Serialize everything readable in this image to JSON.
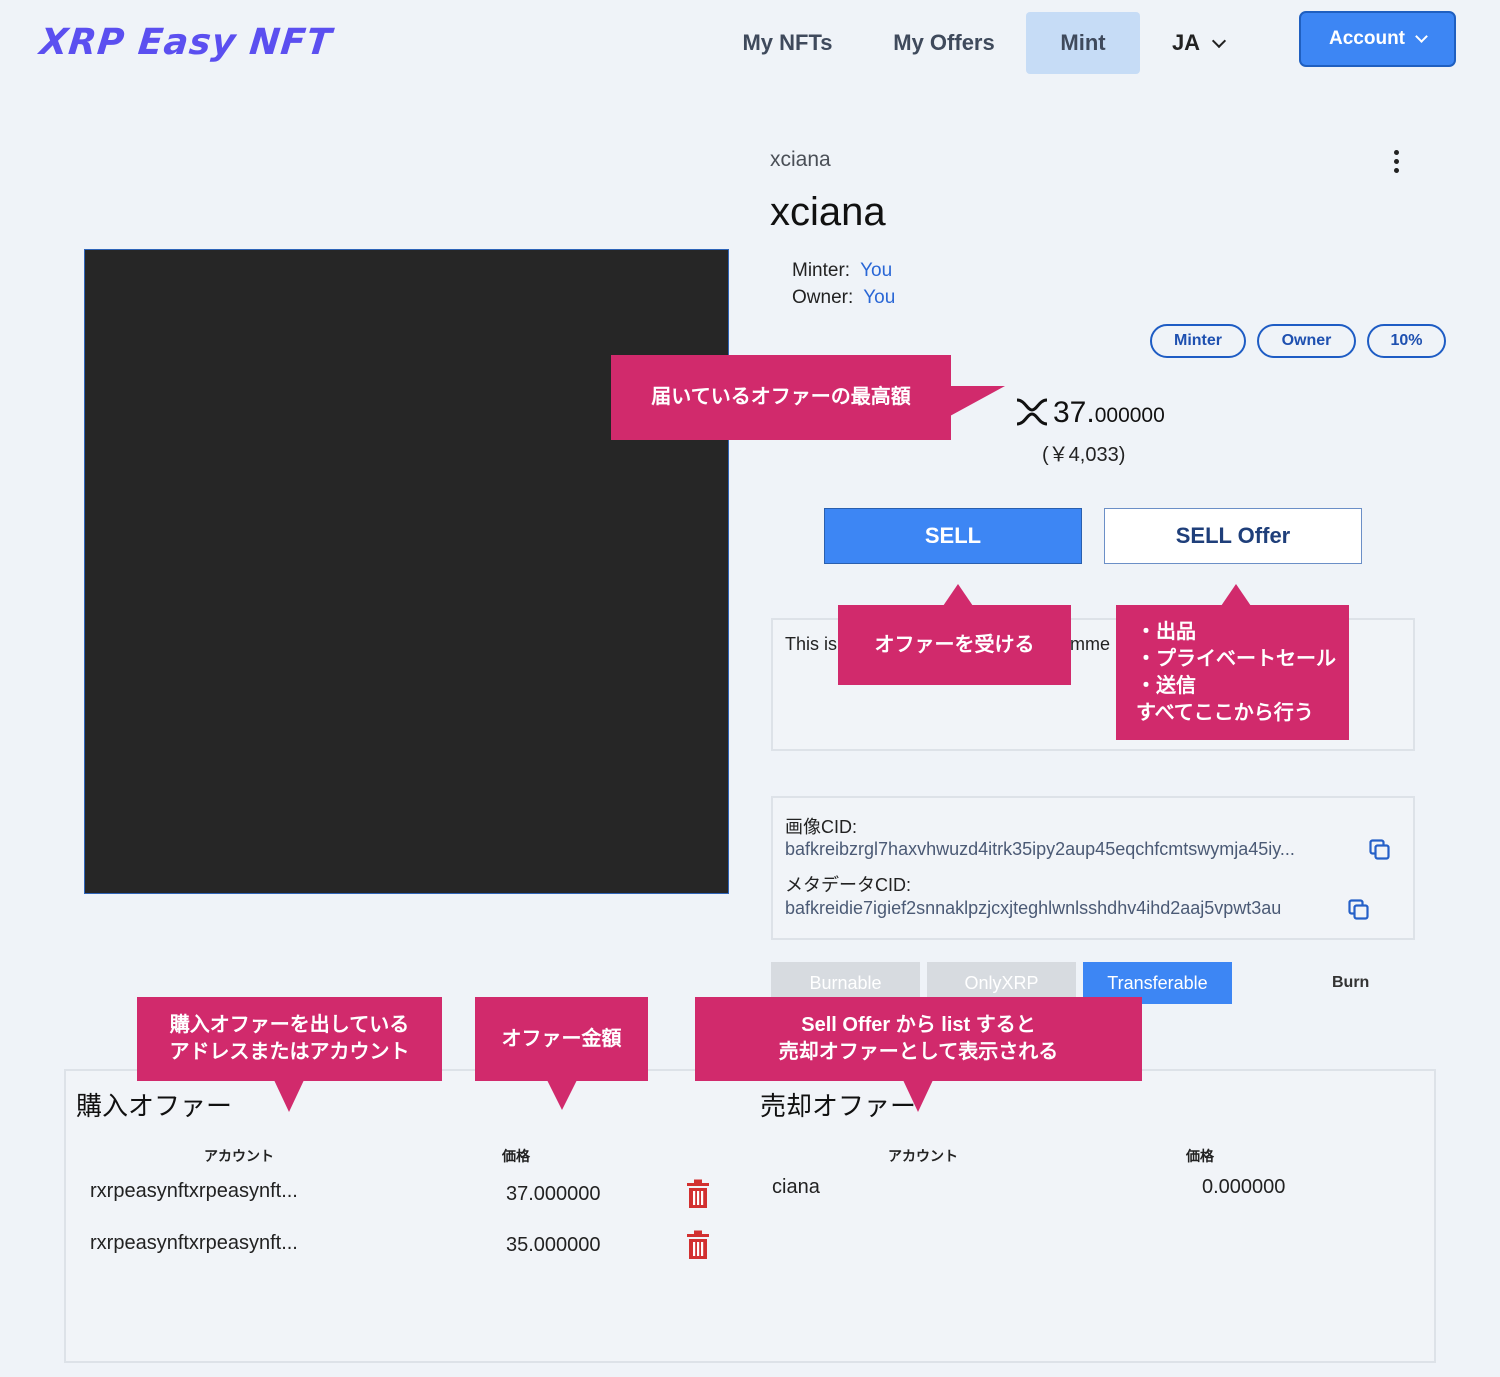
{
  "header": {
    "logo": "XRP Easy NFT",
    "nav": [
      "My NFTs",
      "My Offers",
      "Mint"
    ],
    "active_nav": "Mint",
    "language": "JA",
    "account_label": "Account",
    "accent_color": "#3d86f4",
    "logo_color": "#5b4ff0"
  },
  "nft": {
    "collection": "xciana",
    "name": "xciana",
    "minter_label": "Minter:",
    "minter_value": "You",
    "owner_label": "Owner:",
    "owner_value": "You",
    "badges": [
      "Minter",
      "Owner",
      "10%"
    ],
    "price_int": "37.",
    "price_dec": "000000",
    "price_jpy": "(￥4,033)",
    "sell_label": "SELL",
    "sell_offer_label": "SELL Offer",
    "description_start": "This is",
    "description_end": "mme",
    "image_cid_label": "画像CID:",
    "image_cid": "bafkreibzrgl7haxvhwuzd4itrk35ipy2aup45eqchfcmtswymja45iy...",
    "metadata_cid_label": "メタデータCID:",
    "metadata_cid": "bafkreidie7igief2snnaklpzjcxjteghlwnlsshdhv4ihd2aaj5vpwt3au",
    "flags": [
      "Burnable",
      "OnlyXRP",
      "Transferable"
    ],
    "active_flag": "Transferable",
    "burn_label": "Burn"
  },
  "buy_offers": {
    "title": "購入オファー",
    "col_account": "アカウント",
    "col_price": "価格",
    "rows": [
      {
        "account": "rxrpeasynftxrpeasynft...",
        "price": "37.000000"
      },
      {
        "account": "rxrpeasynftxrpeasynft...",
        "price": "35.000000"
      }
    ]
  },
  "sell_offers": {
    "title": "売却オファー",
    "col_account": "アカウント",
    "col_price": "価格",
    "rows": [
      {
        "account": "ciana",
        "price": "0.000000"
      }
    ]
  },
  "annotations": {
    "highest_offer": "届いているオファーの最高額",
    "accept_offer": "オファーを受ける",
    "sell_offer_actions": [
      "・出品",
      "・プライベートセール",
      "・送信",
      "すべてここから行う"
    ],
    "buy_account": [
      "購入オファーを出している",
      "アドレスまたはアカウント"
    ],
    "offer_amount": "オファー金額",
    "sell_list": [
      "Sell Offer から list すると",
      "売却オファーとして表示される"
    ],
    "callout_color": "#d12a6c"
  }
}
